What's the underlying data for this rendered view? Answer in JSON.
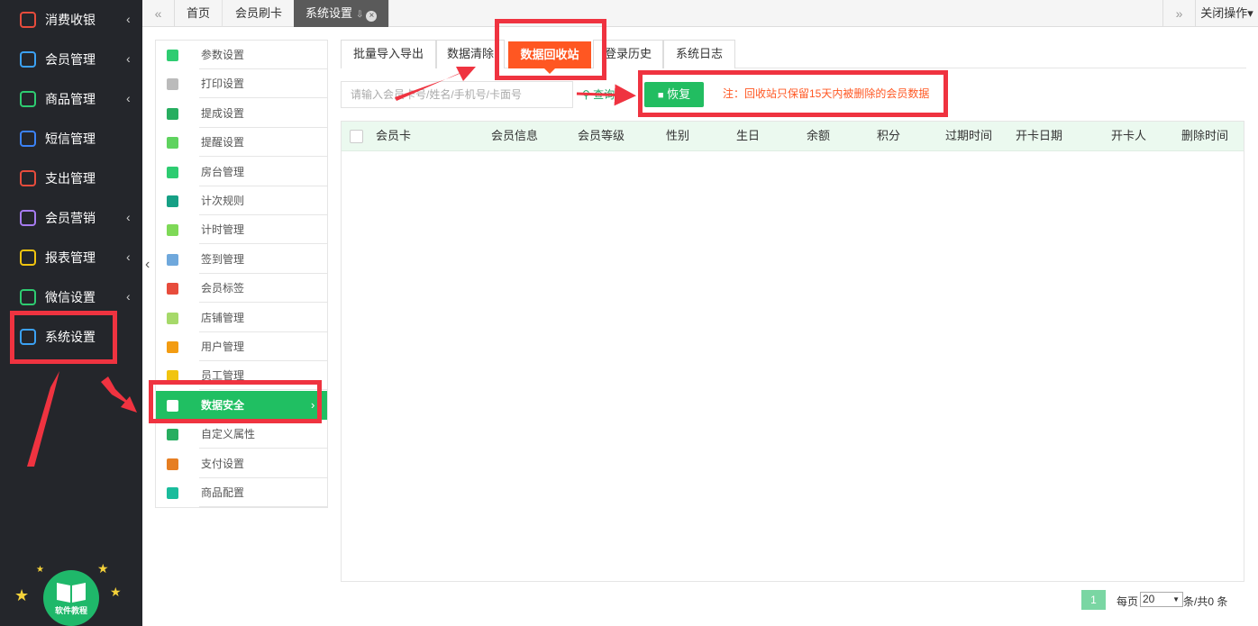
{
  "sidebar": {
    "items": [
      {
        "label": "消费收银",
        "icon": "cash-register-icon",
        "chevron": "‹",
        "color": "#e74c3c"
      },
      {
        "label": "会员管理",
        "icon": "members-icon",
        "chevron": "‹",
        "color": "#3ba1f3"
      },
      {
        "label": "商品管理",
        "icon": "goods-icon",
        "chevron": "‹",
        "color": "#2ecc71"
      },
      {
        "label": "短信管理",
        "icon": "sms-icon",
        "chevron": "",
        "color": "#3b82f6"
      },
      {
        "label": "支出管理",
        "icon": "expense-icon",
        "chevron": "",
        "color": "#e74c3c"
      },
      {
        "label": "会员营销",
        "icon": "gift-icon",
        "chevron": "‹",
        "color": "#a67bf0"
      },
      {
        "label": "报表管理",
        "icon": "report-icon",
        "chevron": "‹",
        "color": "#f1c40f"
      },
      {
        "label": "微信设置",
        "icon": "wechat-icon",
        "chevron": "‹",
        "color": "#2ecc71"
      },
      {
        "label": "系统设置",
        "icon": "gear-icon",
        "chevron": "",
        "color": "#3ba1f3"
      }
    ],
    "tutorial_label": "软件教程"
  },
  "tabbar": {
    "prev": "«",
    "next": "»",
    "tabs": [
      {
        "label": "首页"
      },
      {
        "label": "会员刷卡"
      },
      {
        "label": "系统设置",
        "pin": "⇩",
        "close": "×"
      }
    ],
    "close_ops": "关闭操作▾"
  },
  "settings_menu": {
    "items": [
      {
        "label": "参数设置",
        "color": "#2ecc71"
      },
      {
        "label": "打印设置",
        "color": "#bbbbbb"
      },
      {
        "label": "提成设置",
        "color": "#27ae60"
      },
      {
        "label": "提醒设置",
        "color": "#5fd35f"
      },
      {
        "label": "房台管理",
        "color": "#2ecc71"
      },
      {
        "label": "计次规则",
        "color": "#16a085"
      },
      {
        "label": "计时管理",
        "color": "#7ed957"
      },
      {
        "label": "签到管理",
        "color": "#6fa8dc"
      },
      {
        "label": "会员标签",
        "color": "#e74c3c"
      },
      {
        "label": "店铺管理",
        "color": "#a6d96a"
      },
      {
        "label": "用户管理",
        "color": "#f39c12"
      },
      {
        "label": "员工管理",
        "color": "#f1c40f"
      },
      {
        "label": "数据安全",
        "color": "#ffffff",
        "active": true,
        "chevron": "›"
      },
      {
        "label": "自定义属性",
        "color": "#27ae60"
      },
      {
        "label": "支付设置",
        "color": "#e67e22"
      },
      {
        "label": "商品配置",
        "color": "#1abc9c"
      }
    ]
  },
  "subtabs": [
    {
      "label": "批量导入导出"
    },
    {
      "label": "数据清除"
    },
    {
      "label": "数据回收站",
      "active": true
    },
    {
      "label": "登录历史"
    },
    {
      "label": "系统日志"
    }
  ],
  "toolbar": {
    "search_placeholder": "请输入会员卡号/姓名/手机号/卡面号",
    "search_label": "查询",
    "restore_label": "恢复",
    "note": "注：回收站只保留15天内被删除的会员数据"
  },
  "table": {
    "columns": [
      "会员卡",
      "会员信息",
      "会员等级",
      "性别",
      "生日",
      "余额",
      "积分",
      "过期时间",
      "开卡日期",
      "开卡人",
      "删除时间"
    ],
    "rows": []
  },
  "pager": {
    "current_page": "1",
    "per_page_label": "每页",
    "per_page_value": "20",
    "total_label": "条/共0 条"
  },
  "colors": {
    "accent_green": "#22bd61",
    "accent_orange": "#ff5722",
    "sidebar_bg": "#24262b",
    "annotation_red": "#ef3340"
  }
}
